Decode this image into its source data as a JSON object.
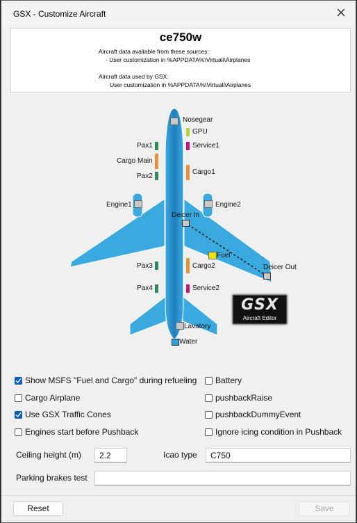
{
  "window": {
    "title": "GSX - Customize Aircraft"
  },
  "info": {
    "aircraft": "ce750w",
    "sources_header": "Aircraft data available from these sources:",
    "sources_item": "· User customization in %APPDATA%\\Virtuali\\Airplanes",
    "used_header": "Aircraft data used by GSX:",
    "used_item": "User customization in %APPDATA%\\Virtuali\\Airplanes"
  },
  "diagram": {
    "labels": {
      "nosegear": "Nosegear",
      "gpu": "GPU",
      "service1": "Service1",
      "pax1": "Pax1",
      "cargo_main": "Cargo Main",
      "cargo1": "Cargo1",
      "pax2": "Pax2",
      "engine1": "Engine1",
      "engine2": "Engine2",
      "deicer_in": "Deicer In",
      "fuel": "Fuel",
      "deicer_out": "Deicer Out",
      "pax3": "Pax3",
      "cargo2": "Cargo2",
      "pax4": "Pax4",
      "service2": "Service2",
      "lavatory": "Lavatory",
      "water": "Water"
    },
    "logo": {
      "big": "GSX",
      "small": "Aircraft Editor"
    },
    "colors": {
      "body": "#2f9fda",
      "body_dark": "#1f7fc0",
      "pax": "#2e8b57",
      "cargo": "#e8923a",
      "service": "#c2187a",
      "gpu": "#b5d334",
      "fuel": "#f2e600",
      "marker": "#c8c8c8"
    }
  },
  "options": {
    "show_msfs_fuel_cargo": {
      "label": "Show MSFS \"Fuel and Cargo\" during refueling",
      "checked": true
    },
    "battery": {
      "label": "Battery",
      "checked": false
    },
    "cargo_airplane": {
      "label": "Cargo Airplane",
      "checked": false
    },
    "pushback_raise": {
      "label": "pushbackRaise",
      "checked": false
    },
    "use_traffic_cones": {
      "label": "Use GSX Traffic Cones",
      "checked": true
    },
    "pushback_dummy_event": {
      "label": "pushbackDummyEvent",
      "checked": false
    },
    "engines_start_before_pushback": {
      "label": "Engines start before Pushback",
      "checked": false
    },
    "ignore_icing": {
      "label": "Ignore icing condition in Pushback",
      "checked": false
    }
  },
  "fields": {
    "ceiling_height_label": "Ceiling height (m)",
    "ceiling_height_value": "2.2",
    "icao_type_label": "Icao type",
    "icao_type_value": "C750",
    "parking_brakes_label": "Parking brakes test",
    "parking_brakes_value": ""
  },
  "buttons": {
    "reset": "Reset",
    "save": "Save"
  }
}
